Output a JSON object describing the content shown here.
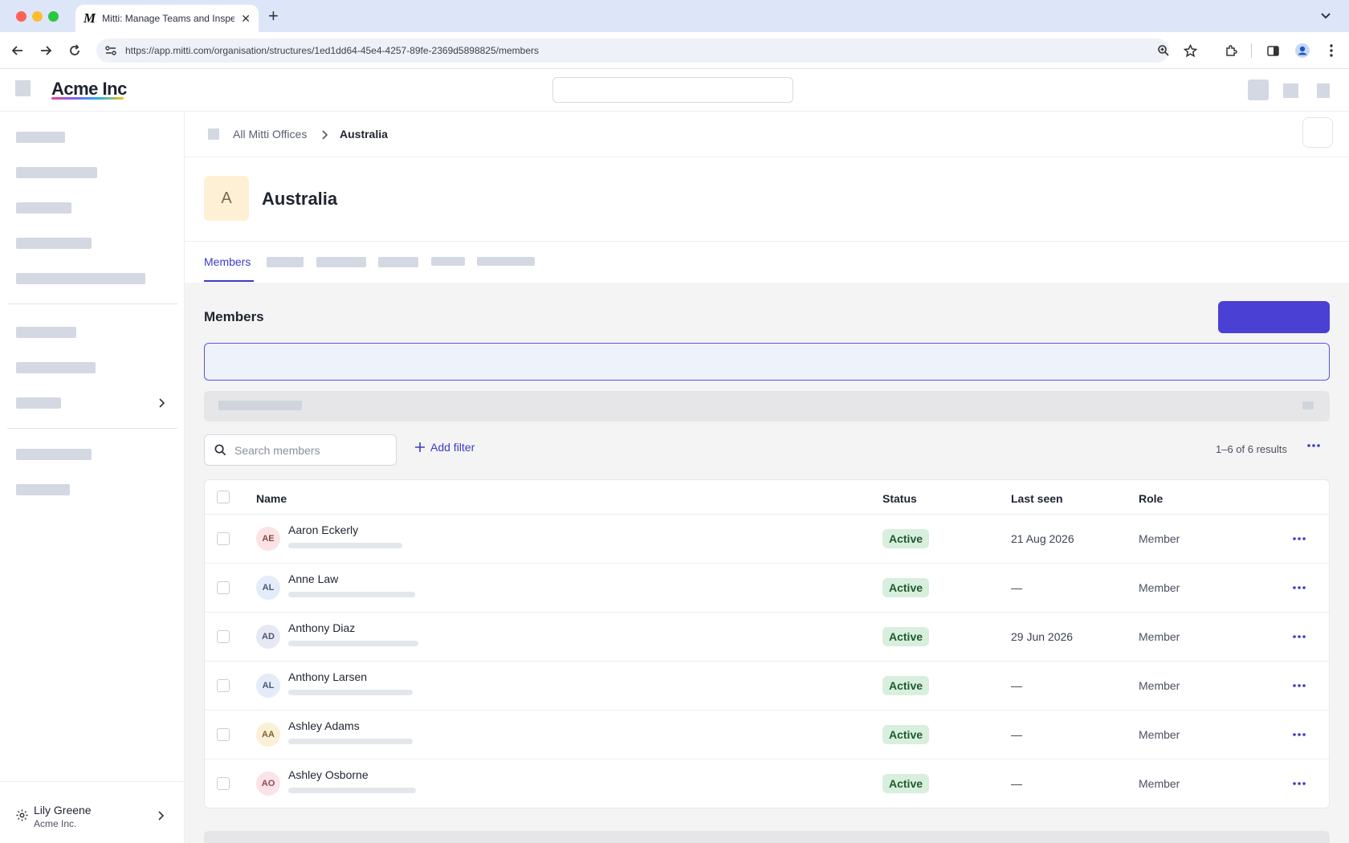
{
  "browser": {
    "tab_title": "Mitti: Manage Teams and Inspect...",
    "tab_logo": "M",
    "url": "https://app.mitti.com/organisation/structures/1ed1dd64-45e4-4257-89fe-2369d5898825/members"
  },
  "app": {
    "brand": "Acme Inc"
  },
  "breadcrumb": {
    "parent": "All Mitti Offices",
    "current": "Australia"
  },
  "page": {
    "avatar_letter": "A",
    "title": "Australia"
  },
  "tabs": {
    "active": "Members"
  },
  "members": {
    "section_title": "Members",
    "search_placeholder": "Search members",
    "add_filter": "Add filter",
    "results": "1–6 of 6 results",
    "columns": {
      "name": "Name",
      "status": "Status",
      "last_seen": "Last seen",
      "role": "Role"
    },
    "rows": [
      {
        "initials": "AE",
        "name": "Aaron Eckerly",
        "status": "Active",
        "last_seen": "21 Aug 2026",
        "role": "Member",
        "avatar_bg": "#fbe3e3",
        "avatar_fg": "#8a4a4a"
      },
      {
        "initials": "AL",
        "name": "Anne Law",
        "status": "Active",
        "last_seen": "—",
        "role": "Member",
        "avatar_bg": "#e3ecf8",
        "avatar_fg": "#4a5a78"
      },
      {
        "initials": "AD",
        "name": "Anthony Diaz",
        "status": "Active",
        "last_seen": "29 Jun 2026",
        "role": "Member",
        "avatar_bg": "#e6e8f4",
        "avatar_fg": "#4f5574"
      },
      {
        "initials": "AL",
        "name": "Anthony Larsen",
        "status": "Active",
        "last_seen": "—",
        "role": "Member",
        "avatar_bg": "#e3ecf8",
        "avatar_fg": "#4a5a78"
      },
      {
        "initials": "AA",
        "name": "Ashley Adams",
        "status": "Active",
        "last_seen": "—",
        "role": "Member",
        "avatar_bg": "#fbefd6",
        "avatar_fg": "#7a6232"
      },
      {
        "initials": "AO",
        "name": "Ashley Osborne",
        "status": "Active",
        "last_seen": "—",
        "role": "Member",
        "avatar_bg": "#fbe3e8",
        "avatar_fg": "#8a4a58"
      }
    ]
  },
  "user": {
    "name": "Lily Greene",
    "org": "Acme Inc."
  },
  "colors": {
    "accent": "#4a40d4",
    "active_badge": "#d9efdd"
  },
  "icons": [
    "back-arrow-icon",
    "forward-arrow-icon",
    "reload-icon",
    "site-settings-icon",
    "zoom-icon",
    "star-icon",
    "extensions-icon",
    "sidepanel-icon",
    "profile-icon",
    "kebab-menu-icon",
    "search-icon",
    "plus-icon",
    "more-horizontal-icon",
    "chevron-right-icon",
    "gear-icon"
  ]
}
